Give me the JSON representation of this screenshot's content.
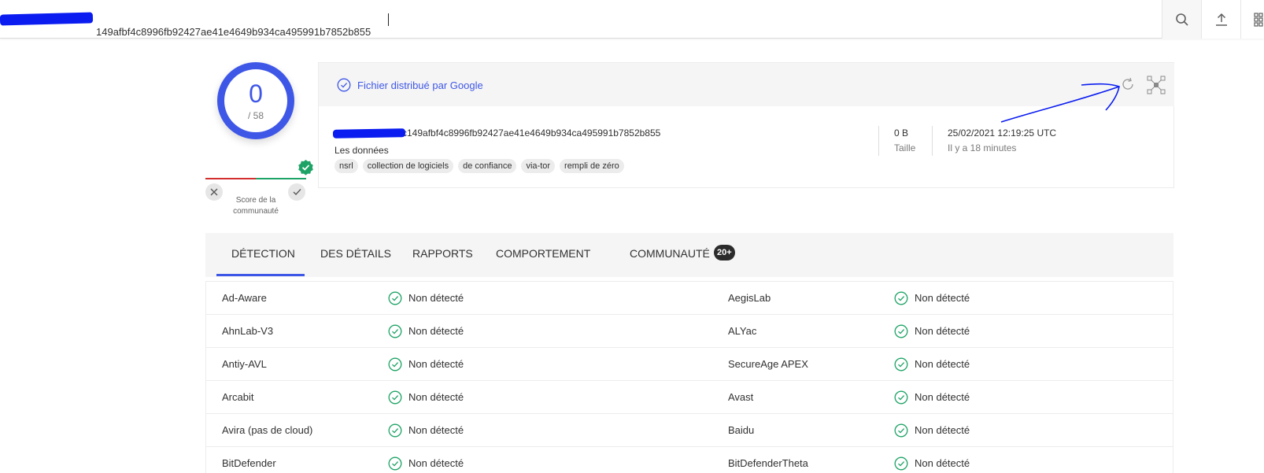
{
  "search": {
    "value": "149afbf4c8996fb92427ae41e4649b934ca495991b7852b855"
  },
  "score": {
    "detections": "0",
    "total": "/ 58",
    "community_label": "Score de la communauté"
  },
  "file": {
    "trusted_label": "Fichier distribué par Google",
    "hash": "c149afbf4c8996fb92427ae41e4649b934ca495991b7852b855",
    "name": "Les données",
    "tags": [
      "nsrl",
      "collection de logiciels",
      "de confiance",
      "via-tor",
      "rempli de zéro"
    ],
    "size_value": "0 B",
    "size_label": "Taille",
    "date_value": "25/02/2021 12:19:25 UTC",
    "date_relative": "Il y a 18 minutes"
  },
  "tabs": {
    "detection": "DÉTECTION",
    "details": "DES DÉTAILS",
    "reports": "RAPPORTS",
    "behavior": "COMPORTEMENT",
    "community": "COMMUNAUTÉ",
    "community_badge": "20+"
  },
  "detections": [
    {
      "engine_left": "Ad-Aware",
      "result_left": "Non détecté",
      "engine_right": "AegisLab",
      "result_right": "Non détecté"
    },
    {
      "engine_left": "AhnLab-V3",
      "result_left": "Non détecté",
      "engine_right": "ALYac",
      "result_right": "Non détecté"
    },
    {
      "engine_left": "Antiy-AVL",
      "result_left": "Non détecté",
      "engine_right": "SecureAge APEX",
      "result_right": "Non détecté"
    },
    {
      "engine_left": "Arcabit",
      "result_left": "Non détecté",
      "engine_right": "Avast",
      "result_right": "Non détecté"
    },
    {
      "engine_left": "Avira (pas de cloud)",
      "result_left": "Non détecté",
      "engine_right": "Baidu",
      "result_right": "Non détecté"
    },
    {
      "engine_left": "BitDefender",
      "result_left": "Non détecté",
      "engine_right": "BitDefenderTheta",
      "result_right": "Non détecté"
    }
  ],
  "colors": {
    "accent": "#3f57e7",
    "ok": "#1ea366",
    "bad": "#d32f2f",
    "redaction": "#0a1cf0"
  },
  "icons": {
    "search": "search-icon",
    "upload": "upload-icon",
    "apps": "apps-grid-icon",
    "trusted": "check-circle-icon",
    "reanalyze": "refresh-icon",
    "similar": "similar-icon",
    "ok": "check-circle-icon"
  }
}
